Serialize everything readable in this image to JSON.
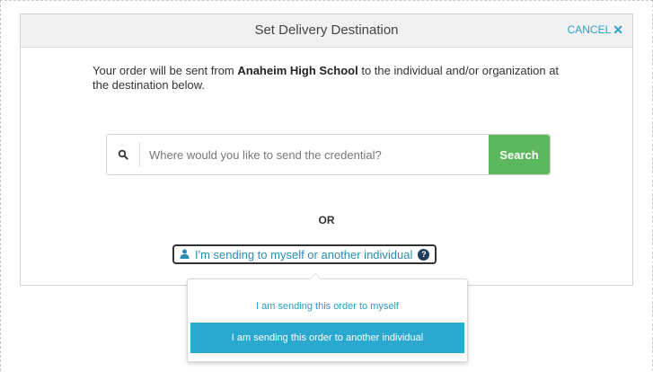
{
  "modal": {
    "title": "Set Delivery Destination",
    "cancel_label": "CANCEL",
    "cancel_icon": "✕"
  },
  "intro": {
    "prefix": "Your order will be sent from ",
    "school": "Anaheim High School",
    "suffix": " to the individual and/or organization at the destination below."
  },
  "search": {
    "placeholder": "Where would you like to send the credential?",
    "button_label": "Search"
  },
  "or_label": "OR",
  "individual_button": {
    "label": "I'm sending to myself or another individual",
    "help_glyph": "?"
  },
  "dropdown": {
    "options": [
      "I am sending this order to myself",
      "I am sending this order to another individual"
    ],
    "highlighted_index": 1
  },
  "colors": {
    "accent": "#2aa3c7",
    "search_button": "#5cb85c",
    "highlight": "#2aa8cf"
  }
}
